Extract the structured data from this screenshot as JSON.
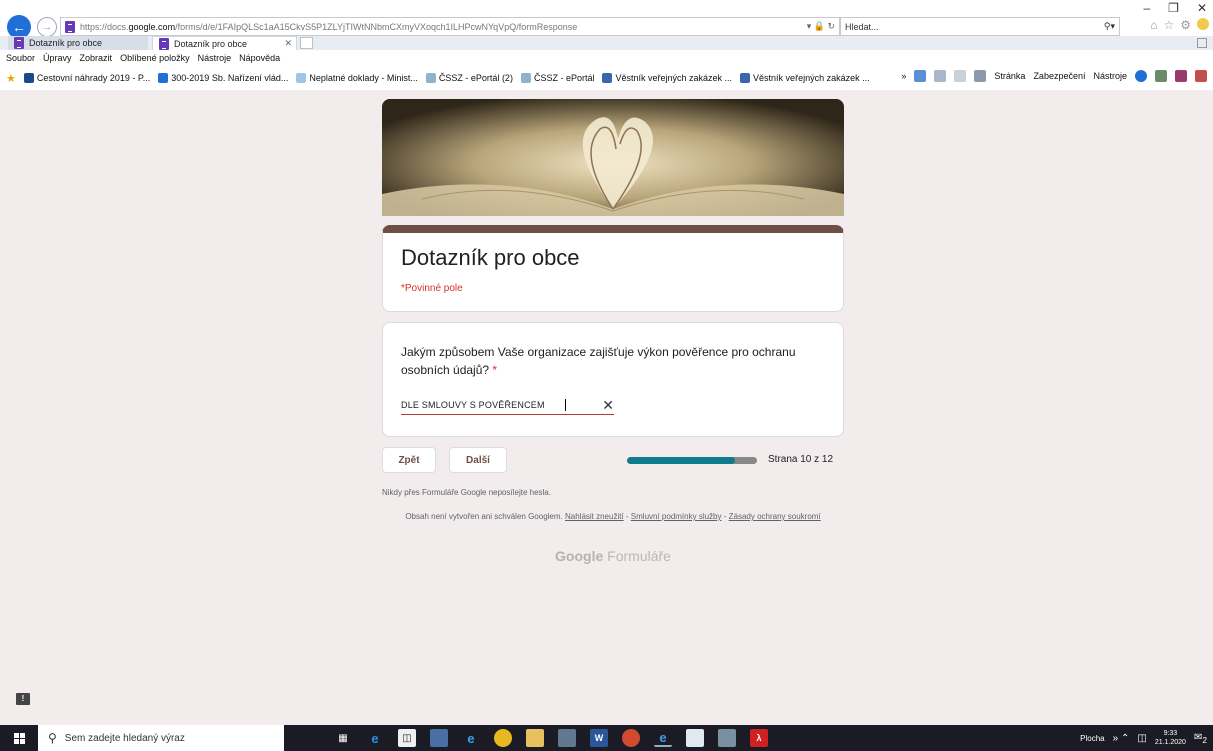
{
  "browser": {
    "url_prefix": "https://docs.",
    "url_domain": "google.com",
    "url_path": "/forms/d/e/1FAIpQLSc1aA15CkvS5P1ZLYjTIWtNNbmCXmyVXoqch1ILHPcwNYqVpQ/formResponse",
    "search_placeholder": "Hledat...",
    "tabs": [
      {
        "label": "Dotazník pro obce"
      },
      {
        "label": "Dotazník pro obce"
      }
    ],
    "menu": [
      "Soubor",
      "Úpravy",
      "Zobrazit",
      "Oblíbené položky",
      "Nástroje",
      "Nápověda"
    ],
    "favorites": [
      {
        "label": "Cestovní náhrady 2019 - P...",
        "icon": "p-icon",
        "color": "#1a4a8a"
      },
      {
        "label": "300-2019 Sb. Nařízení vlád...",
        "icon": "z-icon",
        "color": "#1f6fd6"
      },
      {
        "label": "Neplatné doklady - Minist...",
        "icon": "mail-icon",
        "color": "#9ec5e8"
      },
      {
        "label": "ČSSZ - ePortál (2)",
        "icon": "cssz-icon",
        "color": "#8fb3c9"
      },
      {
        "label": "ČSSZ - ePortál",
        "icon": "cssz-icon",
        "color": "#8fb3c9"
      },
      {
        "label": "Věstník veřejných zakázek ...",
        "icon": "vestnik-icon",
        "color": "#3a66b0"
      },
      {
        "label": "Věstník veřejných zakázek ...",
        "icon": "vestnik-icon",
        "color": "#3a66b0"
      }
    ],
    "tools": {
      "page": "Stránka",
      "security": "Zabezpečení",
      "tools": "Nástroje"
    }
  },
  "form": {
    "title": "Dotazník pro obce",
    "required_note": "*Povinné pole",
    "question": "Jakým způsobem Vaše organizace zajišťuje výkon pověřence pro ochranu osobních údajů?",
    "required_mark": "*",
    "answer_value": "DLE SMLOUVY S POVĚŘENCEM",
    "back_label": "Zpět",
    "next_label": "Další",
    "progress_label": "Strana 10 z 12",
    "progress_fraction": 0.833,
    "accent_color": "#6e4f43",
    "progress_color": "#0f7c8b"
  },
  "footer": {
    "password_warning": "Nikdy přes Formuláře Google neposílejte hesla.",
    "content_note": "Obsah není vytvořen ani schválen Googlem.",
    "report_link": "Nahlásit zneužití",
    "terms_link": "Smluvní podmínky služby",
    "privacy_link": "Zásady ochrany soukromí",
    "logo_brand": "Google",
    "logo_product": "Formuláře"
  },
  "taskbar": {
    "search_placeholder": "Sem zadejte hledaný výraz",
    "desktop_label": "Plocha",
    "time": "9:33",
    "date": "21.1.2020",
    "notifications": "2"
  }
}
